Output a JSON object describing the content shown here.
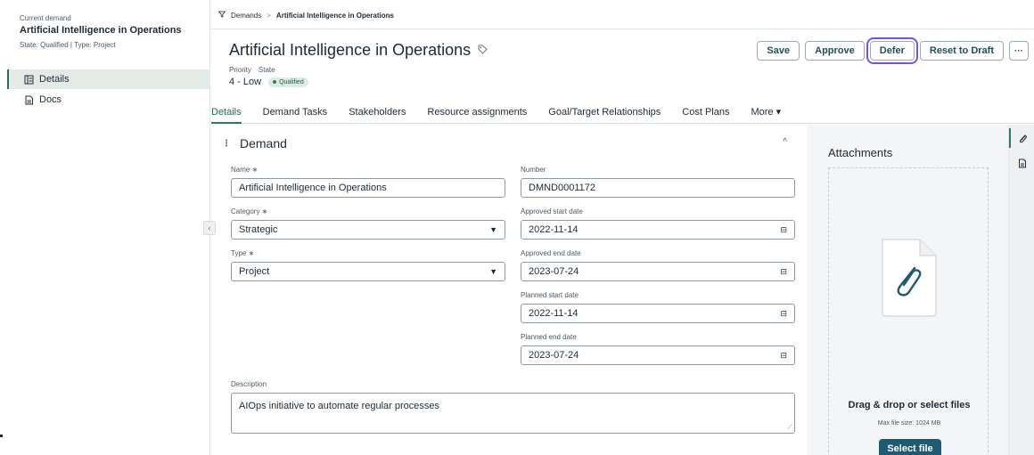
{
  "left_panel": {
    "current_label": "Current demand",
    "title": "Artificial Intelligence in Operations",
    "meta": "State: Qualified  |  Type: Project",
    "nav": [
      {
        "label": "Details",
        "icon": "details-icon"
      },
      {
        "label": "Docs",
        "icon": "doc-icon"
      }
    ]
  },
  "breadcrumb": {
    "root": "Demands",
    "separator": ">",
    "current": "Artificial Intelligence in Operations"
  },
  "record": {
    "title": "Artificial Intelligence in Operations",
    "priority_label": "Priority",
    "state_label": "State",
    "priority_value": "4 - Low",
    "state_value": "Qualified"
  },
  "actions": {
    "save": "Save",
    "approve": "Approve",
    "defer": "Defer",
    "reset": "Reset to Draft",
    "more": "···"
  },
  "tabs": [
    {
      "label": "Details",
      "active": true
    },
    {
      "label": "Demand Tasks"
    },
    {
      "label": "Stakeholders"
    },
    {
      "label": "Resource assignments"
    },
    {
      "label": "Goal/Target Relationships"
    },
    {
      "label": "Cost Plans"
    },
    {
      "label": "More ▾"
    }
  ],
  "demand_section": {
    "title": "Demand",
    "fields": {
      "name": {
        "label": "Name ∗",
        "value": "Artificial Intelligence in Operations"
      },
      "number": {
        "label": "Number",
        "value": "DMND0001172"
      },
      "category": {
        "label": "Category ∗",
        "value": "Strategic"
      },
      "approved_start": {
        "label": "Approved start date",
        "value": "2022-11-14"
      },
      "type": {
        "label": "Type ∗",
        "value": "Project"
      },
      "approved_end": {
        "label": "Approved end date",
        "value": "2023-07-24"
      },
      "planned_start": {
        "label": "Planned start date",
        "value": "2022-11-14"
      },
      "planned_end": {
        "label": "Planned end date",
        "value": "2023-07-24"
      },
      "description": {
        "label": "Description",
        "value": "AIOps initiative to automate regular processes"
      }
    }
  },
  "attachments": {
    "title": "Attachments",
    "drop_text": "Drag & drop or select files",
    "max_size": "Max file size: 1024 MB",
    "select_button": "Select file"
  },
  "colors": {
    "accent": "#2c7a63",
    "primary_button": "#1f5a73",
    "focus_ring": "#7a54d8",
    "state_badge_bg": "#dbece3"
  }
}
